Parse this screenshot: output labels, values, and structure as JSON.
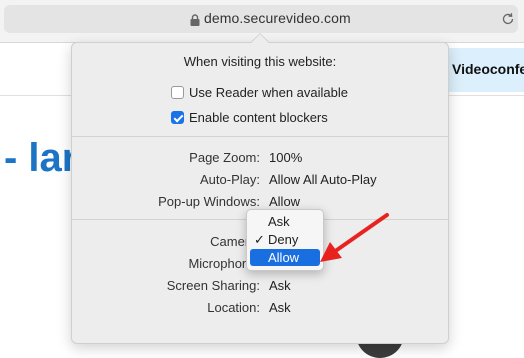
{
  "browser": {
    "url": "demo.securevideo.com"
  },
  "background": {
    "heading_fragment": "- lar",
    "banner_text": "Videoconfe"
  },
  "popover": {
    "title": "When visiting this website:",
    "options": [
      {
        "label": "Use Reader when available",
        "checked": false
      },
      {
        "label": "Enable content blockers",
        "checked": true
      }
    ],
    "settings": [
      {
        "label": "Page Zoom:",
        "value": "100%"
      },
      {
        "label": "Auto-Play:",
        "value": "Allow All Auto-Play"
      },
      {
        "label": "Pop-up Windows:",
        "value": "Allow"
      },
      {
        "label": "Camera:",
        "value": "Deny"
      },
      {
        "label": "Microphone:",
        "value": "Allow"
      },
      {
        "label": "Screen Sharing:",
        "value": "Ask"
      },
      {
        "label": "Location:",
        "value": "Ask"
      }
    ],
    "dropdown": {
      "items": [
        {
          "label": "Ask",
          "selected": false,
          "highlighted": false
        },
        {
          "label": "Deny",
          "selected": true,
          "highlighted": false
        },
        {
          "label": "Allow",
          "selected": false,
          "highlighted": true
        }
      ],
      "check_glyph": "✓"
    }
  },
  "colors": {
    "accent": "#1a6fe0",
    "annotation_arrow": "#e8231f",
    "heading": "#1d74c5"
  }
}
